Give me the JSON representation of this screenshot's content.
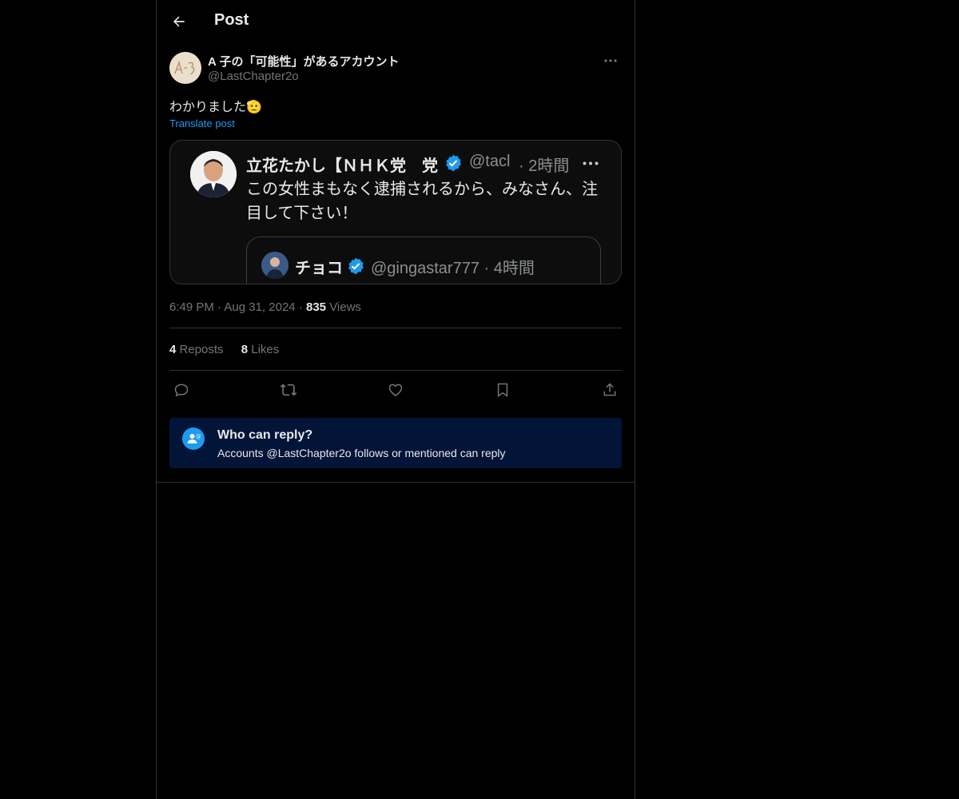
{
  "header": {
    "title": "Post"
  },
  "post": {
    "author_name": "A 子の「可能性」があるアカウント",
    "author_handle": "@LastChapter2o",
    "text": "わかりました",
    "emoji": "🫡",
    "translate_label": "Translate post",
    "time": "6:49 PM",
    "date": "Aug 31, 2024",
    "views_count": "835",
    "views_label": "Views",
    "reposts_count": "4",
    "reposts_label": "Reposts",
    "likes_count": "8",
    "likes_label": "Likes"
  },
  "quoted": {
    "name": "立花たかし【ＮＨＫ党　党",
    "handle": "@tacl",
    "time": "· 2時間",
    "text": "この女性まもなく逮捕されるから、みなさん、注目して下さい！",
    "inner": {
      "name": "チョコ",
      "handle": "@gingastar777 · 4時間"
    }
  },
  "actions": {
    "icons": [
      "reply-icon",
      "repost-icon",
      "like-icon",
      "bookmark-icon",
      "share-icon"
    ]
  },
  "reply_settings": {
    "title": "Who can reply?",
    "subtitle": "Accounts @LastChapter2o follows or mentioned can reply"
  },
  "colors": {
    "background": "#000000",
    "border": "#2f3336",
    "accent": "#1d9bf0",
    "muted_text": "#71767b",
    "reply_box_bg": "#031439"
  }
}
